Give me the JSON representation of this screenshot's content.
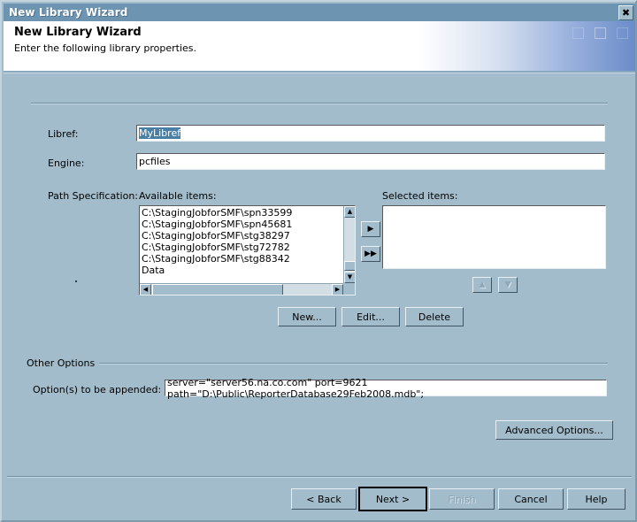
{
  "window": {
    "title": "New Library Wizard",
    "close_icon": "close-icon",
    "close_glyph": "✖"
  },
  "header": {
    "title": "New Library Wizard",
    "subtitle": "Enter the following library properties."
  },
  "form": {
    "libref_label": "Libref:",
    "libref_value": "MyLibref",
    "engine_label": "Engine:",
    "engine_value": "pcfiles",
    "path_label": "Path Specification:",
    "available_label": "Available items:",
    "selected_label": "Selected items:",
    "available_items": [
      "C:\\StagingJobforSMF\\spn33599",
      "C:\\StagingJobforSMF\\spn45681",
      "C:\\StagingJobforSMF\\stg38297",
      "C:\\StagingJobforSMF\\stg72782",
      "C:\\StagingJobforSMF\\stg88342",
      "Data"
    ],
    "selected_items": [],
    "stray_dot": "."
  },
  "transfer_buttons": {
    "add_glyph": "▶",
    "add_all_glyph": "▶▶",
    "move_up_glyph": "▲",
    "move_down_glyph": "▼"
  },
  "item_buttons": {
    "new": "New...",
    "edit": "Edit...",
    "delete": "Delete"
  },
  "other_options": {
    "group_title": "Other Options",
    "options_label": "Option(s) to be appended:",
    "options_value": "server=\"server56.na.co.com\" port=9621 path=\"D:\\Public\\ReporterDatabase29Feb2008.mdb\";",
    "advanced_button": "Advanced Options..."
  },
  "footer": {
    "back": "< Back",
    "next": "Next >",
    "finish": "Finish",
    "cancel": "Cancel",
    "help": "Help"
  },
  "colors": {
    "dialog_bg": "#a3bccb",
    "titlebar": "#6d94b0",
    "selection": "#4a7fa5",
    "field_bg": "#ffffff",
    "disabled_text": "#8aa4b5"
  }
}
